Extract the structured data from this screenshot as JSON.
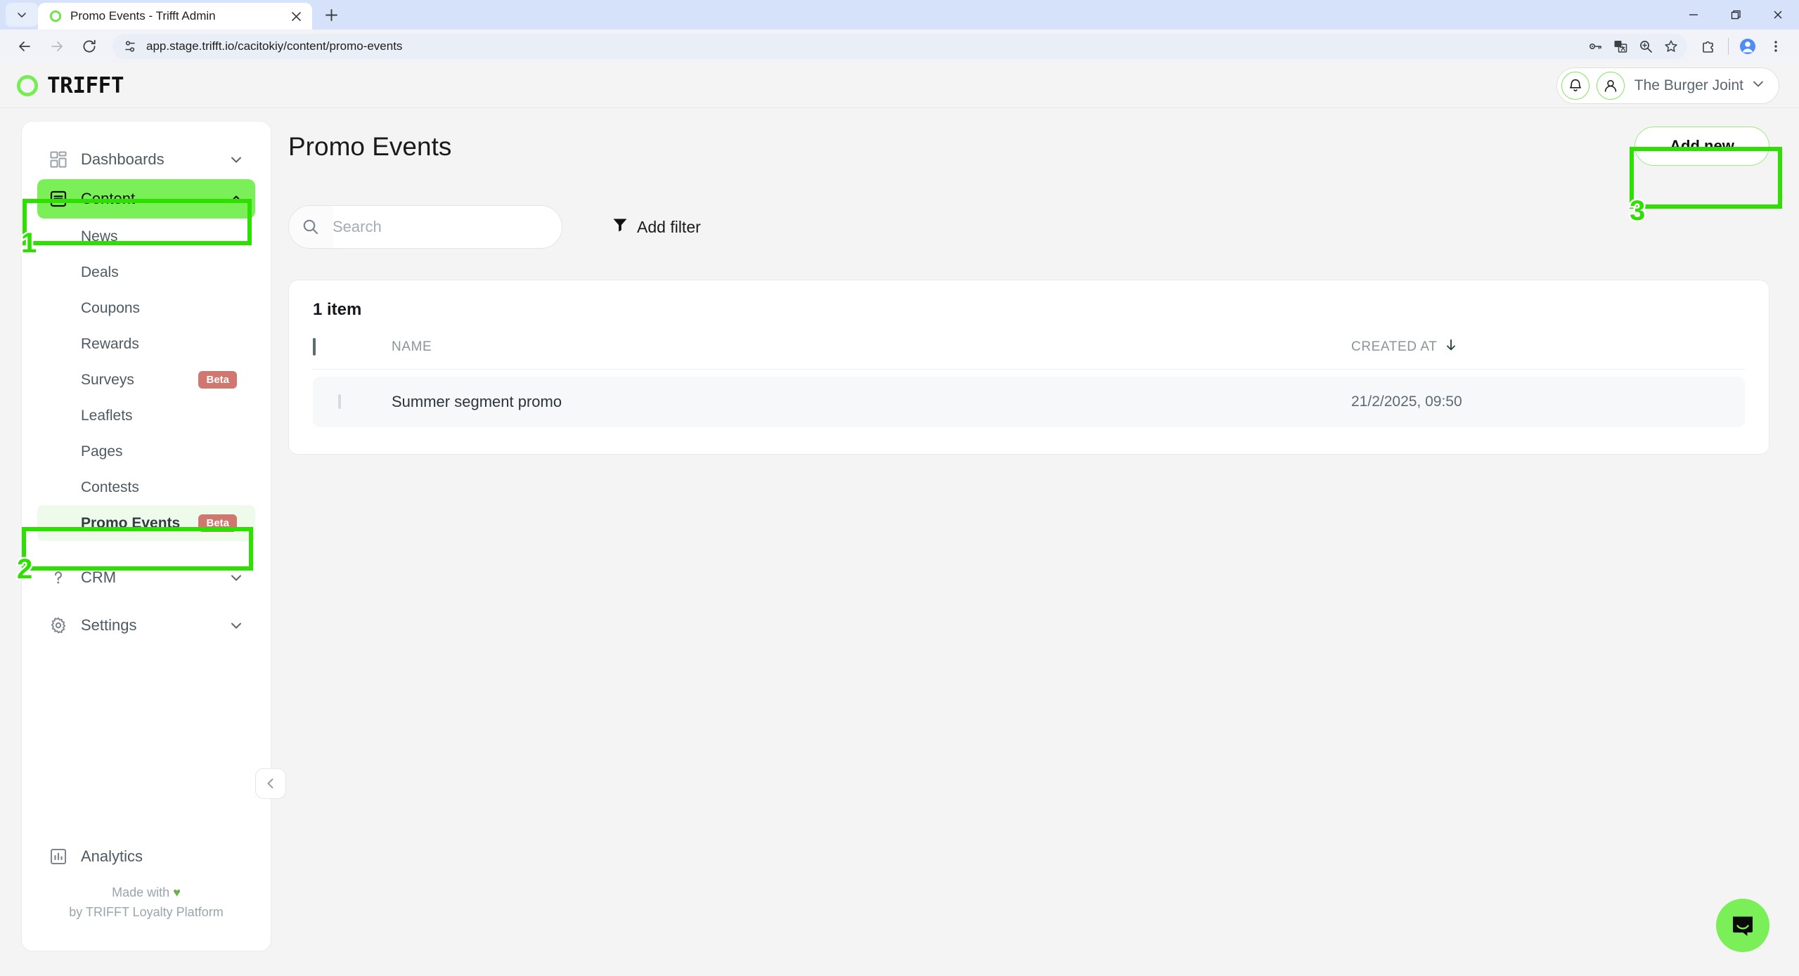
{
  "browser": {
    "tab": {
      "title": "Promo Events - Trifft Admin",
      "favicon": "trifft-ring-icon"
    },
    "new_tab_label": "+",
    "omnibox": {
      "url": "app.stage.trifft.io/cacitokiy/content/promo-events",
      "site_info_icon": "page-settings-icon"
    },
    "toolbar_icons": [
      "back-arrow-icon",
      "forward-arrow-icon",
      "reload-icon"
    ],
    "omnibox_actions": [
      "password-key-icon",
      "translate-icon",
      "zoom-search-icon",
      "bookmark-star-icon"
    ],
    "right_icons": [
      "extensions-puzzle-icon",
      "profile-avatar-icon",
      "chrome-menu-icon"
    ],
    "window_controls": [
      "minimize",
      "maximize",
      "close"
    ]
  },
  "header": {
    "logo_text": "TRIFFT",
    "logo_icon": "trifft-ring-icon",
    "bell_icon": "notification-bell-icon",
    "person_icon": "user-person-icon",
    "org_name": "The Burger Joint",
    "chevron_icon": "chevron-down-icon",
    "accent_green": "#7bef58"
  },
  "sidebar": {
    "groups": [
      {
        "label": "Dashboards",
        "icon": "grid-dashboard-icon",
        "expanded": false,
        "active": false
      },
      {
        "label": "Content",
        "icon": "document-list-icon",
        "expanded": true,
        "active": true
      }
    ],
    "content_items": [
      {
        "label": "News",
        "badge": "",
        "selected": false
      },
      {
        "label": "Deals",
        "badge": "",
        "selected": false
      },
      {
        "label": "Coupons",
        "badge": "",
        "selected": false
      },
      {
        "label": "Rewards",
        "badge": "",
        "selected": false
      },
      {
        "label": "Surveys",
        "badge": "Beta",
        "selected": false
      },
      {
        "label": "Leaflets",
        "badge": "",
        "selected": false
      },
      {
        "label": "Pages",
        "badge": "",
        "selected": false
      },
      {
        "label": "Contests",
        "badge": "",
        "selected": false
      },
      {
        "label": "Promo Events",
        "badge": "Beta",
        "selected": true
      }
    ],
    "lower_groups": [
      {
        "label": "CRM",
        "icon": "question-mark-icon",
        "expanded": false
      },
      {
        "label": "Settings",
        "icon": "gear-icon",
        "expanded": false
      }
    ],
    "analytics": {
      "label": "Analytics",
      "icon": "bar-chart-icon"
    },
    "collapse_icon": "chevron-left-icon",
    "footer_line1": "Made with",
    "footer_heart": "♥",
    "footer_line2": "by TRIFFT Loyalty Platform"
  },
  "main": {
    "page_title": "Promo Events",
    "add_new_label": "Add new",
    "search": {
      "placeholder": "Search",
      "value": "",
      "icon": "search-icon"
    },
    "add_filter": {
      "label": "Add filter",
      "icon": "funnel-filter-icon"
    },
    "item_count": "1 item",
    "table": {
      "columns": [
        "NAME",
        "CREATED AT"
      ],
      "sort_column": "CREATED AT",
      "sort_icon": "arrow-down-icon",
      "rows": [
        {
          "name": "Summer segment promo",
          "created_at": "21/2/2025, 09:50"
        }
      ]
    },
    "chat_icon": "intercom-chat-icon"
  },
  "annotations": [
    {
      "number": "1",
      "target": "content-nav-item"
    },
    {
      "number": "2",
      "target": "promo-events-nav-item"
    },
    {
      "number": "3",
      "target": "add-new-button"
    }
  ]
}
